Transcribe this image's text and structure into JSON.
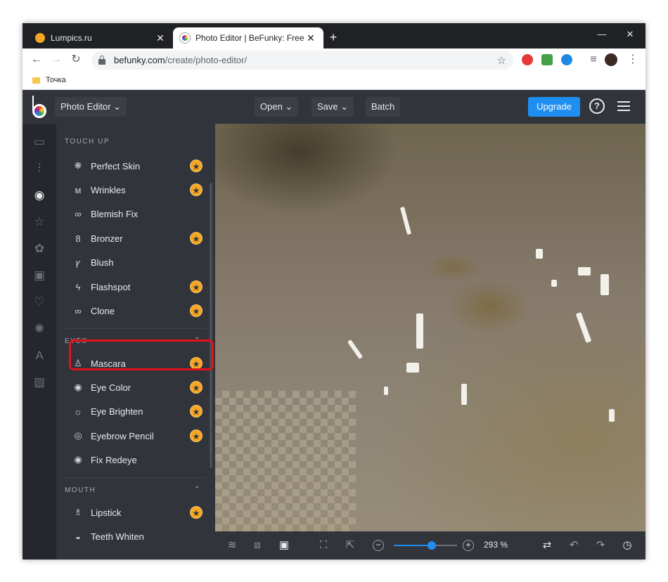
{
  "browser": {
    "tabs": [
      {
        "title": "Lumpics.ru",
        "close": "✕"
      },
      {
        "title": "Photo Editor | BeFunky: Free Onli",
        "close": "✕"
      }
    ],
    "new_tab": "+",
    "window_controls": {
      "minimize": "—",
      "maximize": "☐",
      "close": "✕"
    },
    "url_host": "befunky.com",
    "url_path": "/create/photo-editor/",
    "bookmark": "Точка"
  },
  "app": {
    "mode_label": "Photo Editor ⌄",
    "open_label": "Open ⌄",
    "save_label": "Save ⌄",
    "batch_label": "Batch",
    "upgrade_label": "Upgrade",
    "help_label": "?"
  },
  "panel": {
    "touch_up": {
      "title": "TOUCH UP",
      "items": [
        {
          "label": "Perfect Skin",
          "icon": "❋",
          "premium": true
        },
        {
          "label": "Wrinkles",
          "icon": "ᴍ",
          "premium": true
        },
        {
          "label": "Blemish Fix",
          "icon": "∞",
          "premium": false
        },
        {
          "label": "Bronzer",
          "icon": "8",
          "premium": true
        },
        {
          "label": "Blush",
          "icon": "ꝩ",
          "premium": false
        },
        {
          "label": "Flashspot",
          "icon": "ϟ",
          "premium": true
        },
        {
          "label": "Clone",
          "icon": "∞",
          "premium": true
        }
      ]
    },
    "eyes": {
      "title": "EYES",
      "caret": "⌃",
      "items": [
        {
          "label": "Mascara",
          "icon": "♙",
          "premium": true
        },
        {
          "label": "Eye Color",
          "icon": "◉",
          "premium": true
        },
        {
          "label": "Eye Brighten",
          "icon": "☼",
          "premium": true
        },
        {
          "label": "Eyebrow Pencil",
          "icon": "◎",
          "premium": true
        },
        {
          "label": "Fix Redeye",
          "icon": "◉",
          "premium": false
        }
      ]
    },
    "mouth": {
      "title": "MOUTH",
      "caret": "⌃",
      "items": [
        {
          "label": "Lipstick",
          "icon": "♗",
          "premium": true
        },
        {
          "label": "Teeth Whiten",
          "icon": "◒",
          "premium": false
        }
      ]
    },
    "premium_glyph": "★"
  },
  "rail_icons": [
    "image-icon",
    "adjust-icon",
    "eye-icon",
    "star-icon",
    "flower-icon",
    "frame-icon",
    "heart-icon",
    "badge-icon",
    "text-icon",
    "texture-icon"
  ],
  "bottom": {
    "zoom_label": "293 %",
    "zoom_out": "−",
    "zoom_in": "+",
    "zoom_fraction": 0.6
  },
  "colors": {
    "accent": "#1f8ef1",
    "premium": "#f5a623",
    "highlight": "#e3101a"
  }
}
